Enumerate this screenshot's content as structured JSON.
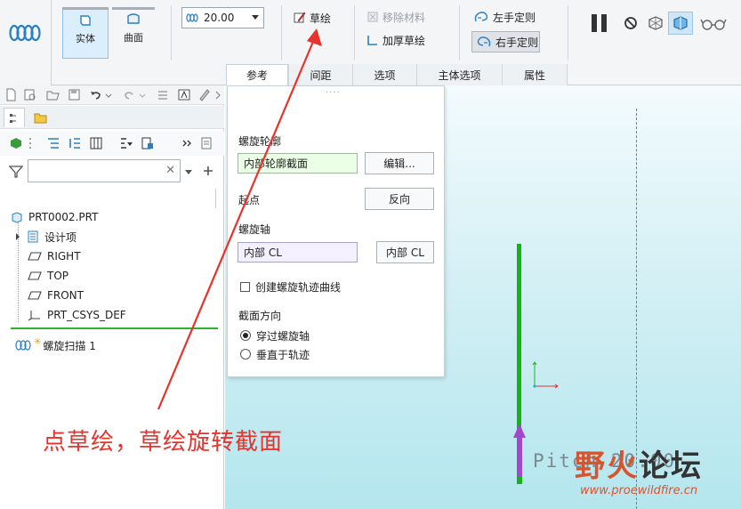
{
  "ribbon": {
    "solid_label": "实体",
    "surface_label": "曲面",
    "pitch_value": "20.00",
    "sketch_label": "草绘",
    "remove_material_label": "移除材料",
    "thicken_label": "加厚草绘",
    "left_hand_label": "左手定则",
    "right_hand_label": "右手定则"
  },
  "tabs": [
    {
      "label": "参考"
    },
    {
      "label": "间距"
    },
    {
      "label": "选项"
    },
    {
      "label": "主体选项"
    },
    {
      "label": "属性"
    }
  ],
  "tree": {
    "root": "PRT0002.PRT",
    "items": [
      {
        "label": "设计项"
      },
      {
        "label": "RIGHT"
      },
      {
        "label": "TOP"
      },
      {
        "label": "FRONT"
      },
      {
        "label": "PRT_CSYS_DEF"
      }
    ],
    "feature": "螺旋扫描 1",
    "filter_value": ""
  },
  "dialog": {
    "profile_label": "螺旋轮廓",
    "profile_value": "内部轮廓截面",
    "edit_button": "编辑...",
    "start_label": "起点",
    "reverse_button": "反向",
    "axis_label": "螺旋轴",
    "axis_value": "内部 CL",
    "axis_button": "内部 CL",
    "create_curve_label": "创建螺旋轨迹曲线",
    "section_orient_label": "截面方向",
    "option_through_axis": "穿过螺旋轴",
    "option_normal_traj": "垂直于轨迹"
  },
  "graphics": {
    "pitch_text": "Pitch 20.00"
  },
  "annotation": {
    "text": "点草绘，草绘旋转截面",
    "color": "#e8322c"
  },
  "watermark": {
    "title_a": "野火",
    "title_b": "论坛",
    "url": "www.proewildfire.cn"
  }
}
